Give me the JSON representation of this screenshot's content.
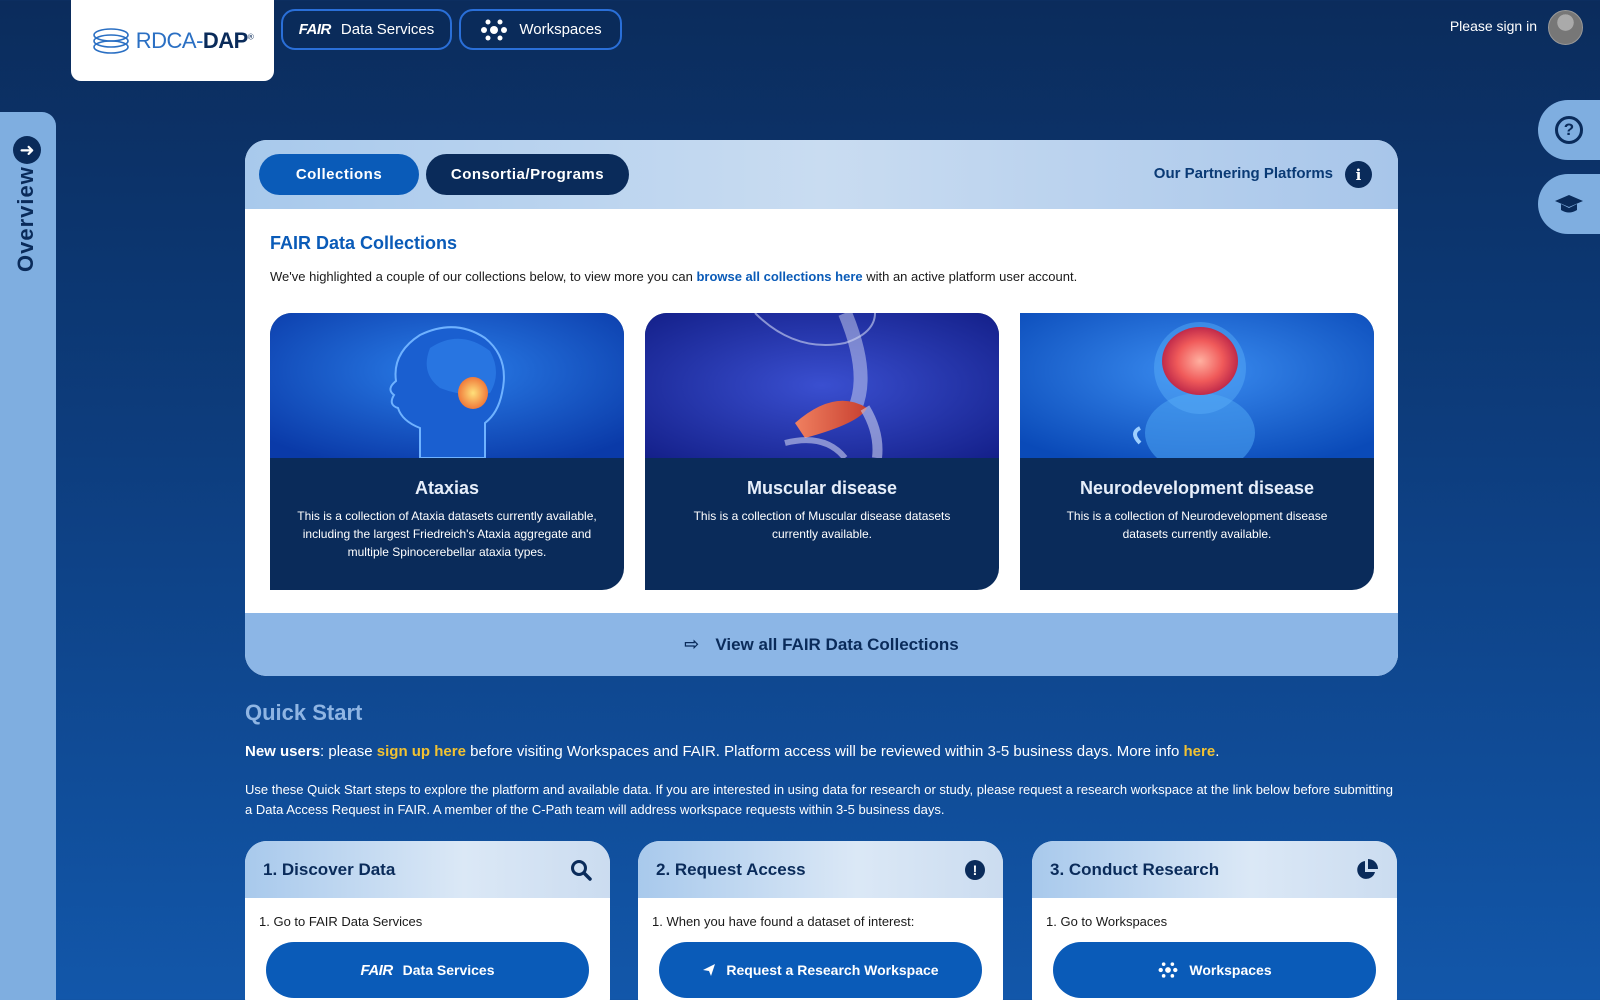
{
  "header": {
    "logo_text_light": "RDCA-",
    "logo_text_bold": "DAP",
    "logo_reg": "®",
    "data_services_fair": "FAIR",
    "data_services_label": "Data Services",
    "workspaces_label": "Workspaces",
    "signin_text": "Please sign in"
  },
  "overview_label": "Overview",
  "tabs": {
    "collections": "Collections",
    "consortia": "Consortia/Programs",
    "partners": "Our Partnering Platforms"
  },
  "collections": {
    "title": "FAIR Data Collections",
    "desc_before": "We've highlighted a couple of our collections below, to view more you can ",
    "desc_link": "browse all collections here",
    "desc_after": " with an active platform user account.",
    "cards": [
      {
        "title": "Ataxias",
        "text": "This is a collection of Ataxia datasets currently available, including the largest Friedreich's Ataxia aggregate and multiple Spinocerebellar ataxia types."
      },
      {
        "title": "Muscular disease",
        "text": "This is a collection of Muscular disease datasets currently available."
      },
      {
        "title": "Neurodevelopment disease",
        "text": "This is a collection of Neurodevelopment disease datasets currently available."
      }
    ],
    "footer_link": "View all FAIR Data Collections"
  },
  "quickstart": {
    "title": "Quick Start",
    "new_users_bold": "New users",
    "new_users_mid": ": please ",
    "signup_link": "sign up here",
    "new_users_after": " before visiting Workspaces and FAIR. Platform access will be reviewed within 3-5 business days. More info ",
    "here_link": "here",
    "period": ".",
    "description": "Use these Quick Start steps to explore the platform and available data. If you are interested in using data for research or study, please request a research workspace at the link below before submitting a Data Access Request in FAIR. A member of the C-Path team will address workspace requests within 3-5 business days.",
    "steps": [
      {
        "title": "1. Discover Data",
        "text": "1. Go to FAIR Data Services",
        "btn_fair": "FAIR",
        "btn": "Data Services"
      },
      {
        "title": "2. Request Access",
        "text": "1. When you have found a dataset of interest:",
        "btn": "Request a Research Workspace"
      },
      {
        "title": "3. Conduct Research",
        "text": "1. Go to Workspaces",
        "btn": "Workspaces"
      }
    ]
  }
}
